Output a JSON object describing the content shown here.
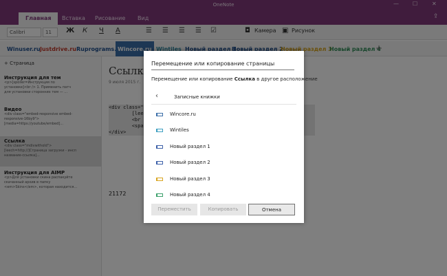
{
  "window": {
    "title": "OneNote",
    "controls": [
      "—",
      "☐",
      "✕"
    ]
  },
  "ribbon": {
    "tabs": [
      "Главная",
      "Вставка",
      "Рисование",
      "Вид"
    ],
    "active_tab": "Главная"
  },
  "toolbar": {
    "font_name": "Calibri",
    "font_size": "11",
    "bold": "Ж",
    "italic": "К",
    "underline": "Ч",
    "color": "А",
    "camera_label": "Камера",
    "picture_label": "Рисунок"
  },
  "sections": {
    "tabs": [
      {
        "label": "Winuser.ru",
        "color": "#1f4e8c"
      },
      {
        "label": "Justdrive.ru",
        "color": "#c0392b"
      },
      {
        "label": "Ruprograms.ru",
        "color": "#1f4e8c"
      },
      {
        "label": "Wincore.ru",
        "color": "#ffffff"
      },
      {
        "label": "Wintiles",
        "color": "#2e86a0"
      },
      {
        "label": "Новый раздел 1",
        "color": "#1f4e8c"
      },
      {
        "label": "Новый раздел 2",
        "color": "#1f4e8c"
      },
      {
        "label": "Новый раздел 3",
        "color": "#d4a017"
      },
      {
        "label": "Новый раздел 4",
        "color": "#2e8b57"
      }
    ],
    "add": "+"
  },
  "pages": {
    "add_label": "Страница",
    "items": [
      {
        "title": "Инструкция для тем",
        "snippet": "<p>[spoiler=Инструкция по\nустановке]<br /> 1. Применить патч\nдля установки сторонних тем — ..."
      },
      {
        "title": "Видео",
        "snippet": "<div class=\"embed-responsive embed-\nresponsive-16by9\">\n[media=https://youtube/embed]..."
      },
      {
        "title": "Ссылка",
        "snippet": "<div class=\"mdivwithold\">\n[leech=http://]Страница загрузки - инсп\nназвание-ссылка]..."
      },
      {
        "title": "Инструкция для AIMP",
        "snippet": "<p>Для установки скина распакуйте\nскачанный архив в папку\n<em>Skins</em>, которая находится..."
      }
    ]
  },
  "document": {
    "title": "Ссылка",
    "date": "9 июля 2015 г.",
    "code": "<div class=\"m\n        [leech=\n        <br />\n        <span c\n</div>",
    "number": "21172"
  },
  "dialog": {
    "heading": "Перемещение или копирование страницы",
    "sub_prefix": "Перемещение или копирование ",
    "sub_bold": "Ссылка",
    "sub_suffix": " в другое расположение",
    "back_glyph": "‹",
    "nav_label": "Записные книжки",
    "items": [
      {
        "label": "Wincore.ru",
        "color": "#3b6ea8"
      },
      {
        "label": "Wintiles",
        "color": "#3b9ec0"
      },
      {
        "label": "Новый раздел 1",
        "color": "#3b5fa8"
      },
      {
        "label": "Новый раздел  2",
        "color": "#3b5fa8"
      },
      {
        "label": "Новый раздел  3",
        "color": "#d9a520"
      },
      {
        "label": "Новый раздел  4",
        "color": "#3aa06a"
      }
    ],
    "buttons": {
      "move": "Переместить",
      "copy": "Копировать",
      "cancel": "Отмена"
    }
  }
}
